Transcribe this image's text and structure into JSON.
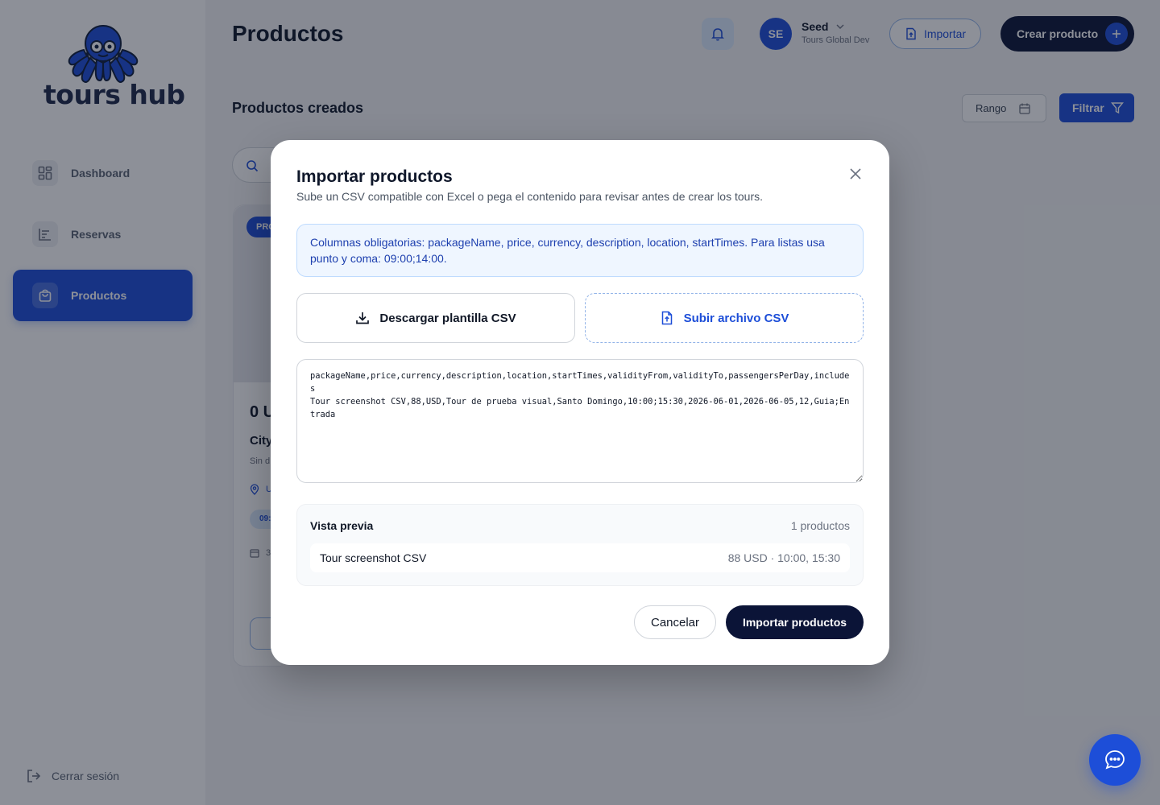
{
  "sidebar": {
    "logo_text": "tours hub",
    "items": [
      {
        "label": "Dashboard",
        "icon": "dashboard-grid-icon",
        "active": false
      },
      {
        "label": "Reservas",
        "icon": "list-icon",
        "active": false
      },
      {
        "label": "Productos",
        "icon": "shopping-bag-icon",
        "active": true
      }
    ],
    "logout_label": "Cerrar sesión"
  },
  "header": {
    "title": "Productos",
    "bell_icon": "bell-icon",
    "user": {
      "initials": "SE",
      "name": "Seed",
      "org": "Tours Global Dev"
    },
    "import_label": "Importar",
    "create_label": "Crear producto"
  },
  "toolbar": {
    "section_title": "Productos creados",
    "range_label": "Rango",
    "filter_label": "Filtrar"
  },
  "background_card": {
    "badge": "PRO",
    "price": "0 U",
    "name": "City",
    "desc": "Sin d",
    "location": "U",
    "time": "09:",
    "date": "3"
  },
  "modal": {
    "title": "Importar productos",
    "subtitle": "Sube un CSV compatible con Excel o pega el contenido para revisar antes de crear los tours.",
    "info": "Columnas obligatorias: packageName, price, currency, description, location, startTimes. Para listas usa punto y coma: 09:00;14:00.",
    "download_label": "Descargar plantilla CSV",
    "upload_label": "Subir archivo CSV",
    "csv_content": "packageName,price,currency,description,location,startTimes,validityFrom,validityTo,passengersPerDay,includes\nTour screenshot CSV,88,USD,Tour de prueba visual,Santo Domingo,10:00;15:30,2026-06-01,2026-06-05,12,Guia;Entrada",
    "preview": {
      "title": "Vista previa",
      "count": "1 productos",
      "rows": [
        {
          "name": "Tour screenshot CSV",
          "meta": "88 USD · 10:00, 15:30"
        }
      ]
    },
    "cancel_label": "Cancelar",
    "submit_label": "Importar productos"
  },
  "colors": {
    "primary": "#1d4ed8",
    "dark": "#0b1437",
    "info_bg": "#eff6ff",
    "info_text": "#1e40af"
  }
}
